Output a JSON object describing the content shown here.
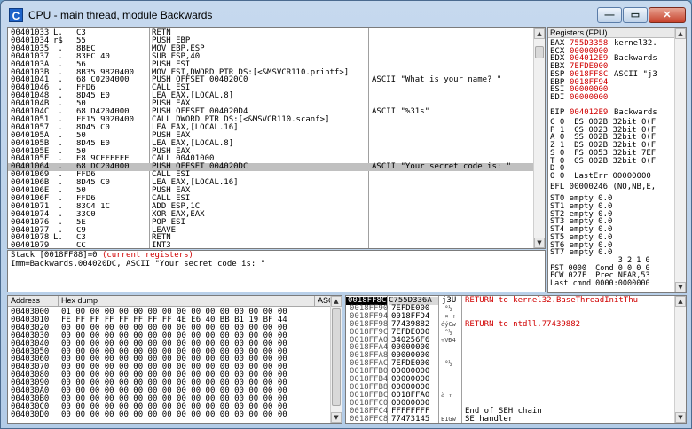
{
  "window": {
    "title": "CPU - main thread, module Backwards",
    "icon_letter": "C",
    "min": "—",
    "max": "▭",
    "close": "✕"
  },
  "disasm": {
    "rows": [
      {
        "addr": "00401033",
        "mark": "L.",
        "hex": "C3",
        "cmd": "RETN",
        "cmt": ""
      },
      {
        "addr": "00401034",
        "mark": "r$",
        "hex": "55",
        "cmd": "PUSH EBP",
        "cmt": ""
      },
      {
        "addr": "00401035",
        "mark": " .",
        "hex": "8BEC",
        "cmd": "MOV EBP,ESP",
        "cmt": ""
      },
      {
        "addr": "00401037",
        "mark": " .",
        "hex": "83EC 40",
        "cmd": "SUB ESP,40",
        "cmt": ""
      },
      {
        "addr": "0040103A",
        "mark": " .",
        "hex": "56",
        "cmd": "PUSH ESI",
        "cmt": ""
      },
      {
        "addr": "0040103B",
        "mark": " .",
        "hex": "8B35 9820400",
        "cmd": "MOV ESI,DWORD PTR DS:[<&MSVCR110.printf>]",
        "cmt": ""
      },
      {
        "addr": "00401041",
        "mark": " .",
        "hex": "68 C0204000",
        "cmd": "PUSH OFFSET 004020C0",
        "cmt": "ASCII \"What is your name? \""
      },
      {
        "addr": "00401046",
        "mark": " .",
        "hex": "FFD6",
        "cmd": "CALL ESI",
        "cmt": ""
      },
      {
        "addr": "00401048",
        "mark": " .",
        "hex": "8D45 E0",
        "cmd": "LEA EAX,[LOCAL.8]",
        "cmt": ""
      },
      {
        "addr": "0040104B",
        "mark": " .",
        "hex": "50",
        "cmd": "PUSH EAX",
        "cmt": ""
      },
      {
        "addr": "0040104C",
        "mark": " .",
        "hex": "68 D4204000",
        "cmd": "PUSH OFFSET 004020D4",
        "cmt": "ASCII \"%31s\""
      },
      {
        "addr": "00401051",
        "mark": " .",
        "hex": "FF15 9020400",
        "cmd": "CALL DWORD PTR DS:[<&MSVCR110.scanf>]",
        "cmt": ""
      },
      {
        "addr": "00401057",
        "mark": " .",
        "hex": "8D45 C0",
        "cmd": "LEA EAX,[LOCAL.16]",
        "cmt": ""
      },
      {
        "addr": "0040105A",
        "mark": " .",
        "hex": "50",
        "cmd": "PUSH EAX",
        "cmt": ""
      },
      {
        "addr": "0040105B",
        "mark": " .",
        "hex": "8D45 E0",
        "cmd": "LEA EAX,[LOCAL.8]",
        "cmt": ""
      },
      {
        "addr": "0040105E",
        "mark": " .",
        "hex": "50",
        "cmd": "PUSH EAX",
        "cmt": ""
      },
      {
        "addr": "0040105F",
        "mark": " .",
        "hex": "E8 9CFFFFFF",
        "cmd": "CALL 00401000",
        "cmt": ""
      },
      {
        "addr": "00401064",
        "mark": " .",
        "hex": "68 DC204000",
        "cmd": "PUSH OFFSET 004020DC",
        "cmt": "ASCII \"Your secret code is: \""
      },
      {
        "addr": "00401069",
        "mark": " .",
        "hex": "FFD6",
        "cmd": "CALL ESI",
        "cmt": ""
      },
      {
        "addr": "0040106B",
        "mark": " .",
        "hex": "8D45 C0",
        "cmd": "LEA EAX,[LOCAL.16]",
        "cmt": ""
      },
      {
        "addr": "0040106E",
        "mark": " .",
        "hex": "50",
        "cmd": "PUSH EAX",
        "cmt": ""
      },
      {
        "addr": "0040106F",
        "mark": " .",
        "hex": "FFD6",
        "cmd": "CALL ESI",
        "cmt": ""
      },
      {
        "addr": "00401071",
        "mark": " .",
        "hex": "83C4 1C",
        "cmd": "ADD ESP,1C",
        "cmt": ""
      },
      {
        "addr": "00401074",
        "mark": " .",
        "hex": "33C0",
        "cmd": "XOR EAX,EAX",
        "cmt": ""
      },
      {
        "addr": "00401076",
        "mark": " .",
        "hex": "5E",
        "cmd": "POP ESI",
        "cmt": ""
      },
      {
        "addr": "00401077",
        "mark": " .",
        "hex": "C9",
        "cmd": "LEAVE",
        "cmt": ""
      },
      {
        "addr": "00401078",
        "mark": "L.",
        "hex": "C3",
        "cmd": "RETN",
        "cmt": ""
      },
      {
        "addr": "00401079",
        "mark": "  ",
        "hex": "CC",
        "cmd": "INT3",
        "cmt": ""
      }
    ],
    "selected_index": 17
  },
  "registers": {
    "header": "Registers (FPU)",
    "rows": [
      {
        "name": "EAX",
        "val": "755D3358",
        "note": "kernel32.",
        "red": true
      },
      {
        "name": "ECX",
        "val": "00000000",
        "note": "",
        "red": true
      },
      {
        "name": "EDX",
        "val": "004012E9",
        "note": "Backwards",
        "red": true
      },
      {
        "name": "EBX",
        "val": "7EFDE000",
        "note": "",
        "red": true
      },
      {
        "name": "ESP",
        "val": "0018FF8C",
        "note": "ASCII \"j3",
        "red": true
      },
      {
        "name": "EBP",
        "val": "0018FF94",
        "note": "",
        "red": true
      },
      {
        "name": "ESI",
        "val": "00000000",
        "note": "",
        "red": true
      },
      {
        "name": "EDI",
        "val": "00000000",
        "note": "",
        "red": true
      },
      {
        "name": "",
        "val": "",
        "note": "",
        "red": false
      },
      {
        "name": "EIP",
        "val": "004012E9",
        "note": "Backwards",
        "red": true
      }
    ],
    "flags": [
      "C 0  ES 002B 32bit 0(F",
      "P 1  CS 0023 32bit 0(F",
      "A 0  SS 002B 32bit 0(F",
      "Z 1  DS 002B 32bit 0(F",
      "S 0  FS 0053 32bit 7EF",
      "T 0  GS 002B 32bit 0(F",
      "D 0",
      "O 0  LastErr 00000000"
    ],
    "efl": "EFL 00000246 (NO,NB,E,",
    "fpu": [
      "ST0 empty 0.0",
      "ST1 empty 0.0",
      "ST2 empty 0.0",
      "ST3 empty 0.0",
      "ST4 empty 0.0",
      "ST5 empty 0.0",
      "ST6 empty 0.0",
      "ST7 empty 0.0"
    ],
    "fpu_tail": [
      "               3 2 1 0",
      "FST 0000  Cond 0 0 0 0",
      "FCW 027F  Prec NEAR,53",
      "Last cmnd 0000:0000000"
    ]
  },
  "info": {
    "line1": "Stack [0018FF88]=0 ",
    "line1_red": "(current registers)",
    "line2": "Imm=Backwards.004020DC, ASCII \"Your secret code is: \""
  },
  "dump": {
    "headers": {
      "address": "Address",
      "hex": "Hex dump",
      "ascii": "ASC"
    },
    "rows": [
      {
        "addr": "00403000",
        "hex": "01 00 00 00 00 00 00 00 00 00 00 00 00 00 00 00"
      },
      {
        "addr": "00403010",
        "hex": "FE FF FF FF FF FF FF FF 4E E6 40 BB B1 19 BF 44"
      },
      {
        "addr": "00403020",
        "hex": "00 00 00 00 00 00 00 00 00 00 00 00 00 00 00 00"
      },
      {
        "addr": "00403030",
        "hex": "00 00 00 00 00 00 00 00 00 00 00 00 00 00 00 00"
      },
      {
        "addr": "00403040",
        "hex": "00 00 00 00 00 00 00 00 00 00 00 00 00 00 00 00"
      },
      {
        "addr": "00403050",
        "hex": "00 00 00 00 00 00 00 00 00 00 00 00 00 00 00 00"
      },
      {
        "addr": "00403060",
        "hex": "00 00 00 00 00 00 00 00 00 00 00 00 00 00 00 00"
      },
      {
        "addr": "00403070",
        "hex": "00 00 00 00 00 00 00 00 00 00 00 00 00 00 00 00"
      },
      {
        "addr": "00403080",
        "hex": "00 00 00 00 00 00 00 00 00 00 00 00 00 00 00 00"
      },
      {
        "addr": "00403090",
        "hex": "00 00 00 00 00 00 00 00 00 00 00 00 00 00 00 00"
      },
      {
        "addr": "004030A0",
        "hex": "00 00 00 00 00 00 00 00 00 00 00 00 00 00 00 00"
      },
      {
        "addr": "004030B0",
        "hex": "00 00 00 00 00 00 00 00 00 00 00 00 00 00 00 00"
      },
      {
        "addr": "004030C0",
        "hex": "00 00 00 00 00 00 00 00 00 00 00 00 00 00 00 00"
      },
      {
        "addr": "004030D0",
        "hex": "00 00 00 00 00 00 00 00 00 00 00 00 00 00 00 00"
      }
    ]
  },
  "stack": {
    "header": {
      "addr": "0018FF8C",
      "val": "C755D336A",
      "asc": "j3U"
    },
    "header_note": "RETURN to kernel32.BaseThreadInitThu",
    "rows": [
      {
        "addr": "0018FF90",
        "val": "7EFDE000",
        "asc": " °½",
        "note": ""
      },
      {
        "addr": "0018FF94",
        "val": "0018FFD4",
        "asc": " ¤ ↑",
        "note": ""
      },
      {
        "addr": "0018FF98",
        "val": "77439882",
        "asc": "éýCw",
        "note": "RETURN to ntdll.77439882"
      },
      {
        "addr": "0018FF9C",
        "val": "7EFDE000",
        "asc": " °½",
        "note": ""
      },
      {
        "addr": "0018FFA0",
        "val": "340256F6",
        "asc": "÷VÐ4",
        "note": ""
      },
      {
        "addr": "0018FFA4",
        "val": "00000000",
        "asc": "",
        "note": ""
      },
      {
        "addr": "0018FFA8",
        "val": "00000000",
        "asc": "",
        "note": ""
      },
      {
        "addr": "0018FFAC",
        "val": "7EFDE000",
        "asc": " °½",
        "note": ""
      },
      {
        "addr": "0018FFB0",
        "val": "00000000",
        "asc": "",
        "note": ""
      },
      {
        "addr": "0018FFB4",
        "val": "00000000",
        "asc": "",
        "note": ""
      },
      {
        "addr": "0018FFB8",
        "val": "00000000",
        "asc": "",
        "note": ""
      },
      {
        "addr": "0018FFBC",
        "val": "0018FFA0",
        "asc": "à ↑",
        "note": ""
      },
      {
        "addr": "0018FFC0",
        "val": "00000000",
        "asc": "",
        "note": ""
      },
      {
        "addr": "0018FFC4",
        "val": "FFFFFFFF",
        "asc": "",
        "note": "End of SEH chain"
      },
      {
        "addr": "0018FFC8",
        "val": "77473145",
        "asc": "E1Gw",
        "note": "SE handler"
      }
    ]
  }
}
